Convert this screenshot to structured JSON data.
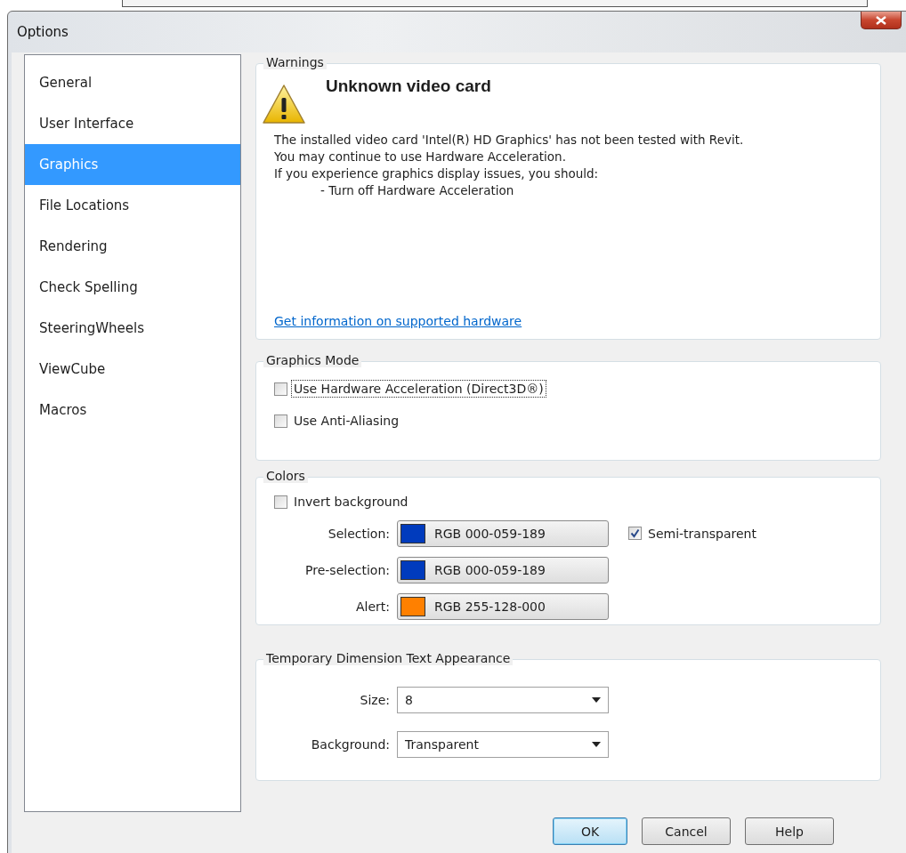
{
  "window": {
    "title": "Options"
  },
  "sidebar": {
    "items": [
      {
        "label": "General",
        "selected": false
      },
      {
        "label": "User Interface",
        "selected": false
      },
      {
        "label": "Graphics",
        "selected": true
      },
      {
        "label": "File Locations",
        "selected": false
      },
      {
        "label": "Rendering",
        "selected": false
      },
      {
        "label": "Check Spelling",
        "selected": false
      },
      {
        "label": "SteeringWheels",
        "selected": false
      },
      {
        "label": "ViewCube",
        "selected": false
      },
      {
        "label": "Macros",
        "selected": false
      }
    ]
  },
  "warnings": {
    "title": "Warnings",
    "heading": "Unknown video card",
    "lines": [
      "The installed video card 'Intel(R) HD Graphics' has not been tested with Revit.",
      "You may continue to use Hardware Acceleration.",
      "If you experience graphics display issues, you should:",
      "- Turn off Hardware Acceleration"
    ],
    "link": "Get information on supported hardware"
  },
  "graphics_mode": {
    "title": "Graphics Mode",
    "options": [
      {
        "label": "Use Hardware Acceleration (Direct3D®)",
        "checked": false,
        "focused": true
      },
      {
        "label": "Use Anti-Aliasing",
        "checked": false,
        "focused": false
      }
    ]
  },
  "colors": {
    "title": "Colors",
    "invert": {
      "label": "Invert background",
      "checked": false
    },
    "rows": [
      {
        "label": "Selection:",
        "value": "RGB 000-059-189",
        "color": "#003bbd"
      },
      {
        "label": "Pre-selection:",
        "value": "RGB 000-059-189",
        "color": "#003bbd"
      },
      {
        "label": "Alert:",
        "value": "RGB 255-128-000",
        "color": "#ff8000"
      }
    ],
    "semi_transparent": {
      "label": "Semi-transparent",
      "checked": true
    }
  },
  "temporary_dimension": {
    "title": "Temporary Dimension Text Appearance",
    "fields": [
      {
        "label": "Size:",
        "value": "8"
      },
      {
        "label": "Background:",
        "value": "Transparent"
      }
    ]
  },
  "buttons": [
    {
      "label": "OK",
      "default": true
    },
    {
      "label": "Cancel",
      "default": false
    },
    {
      "label": "Help",
      "default": false
    }
  ]
}
